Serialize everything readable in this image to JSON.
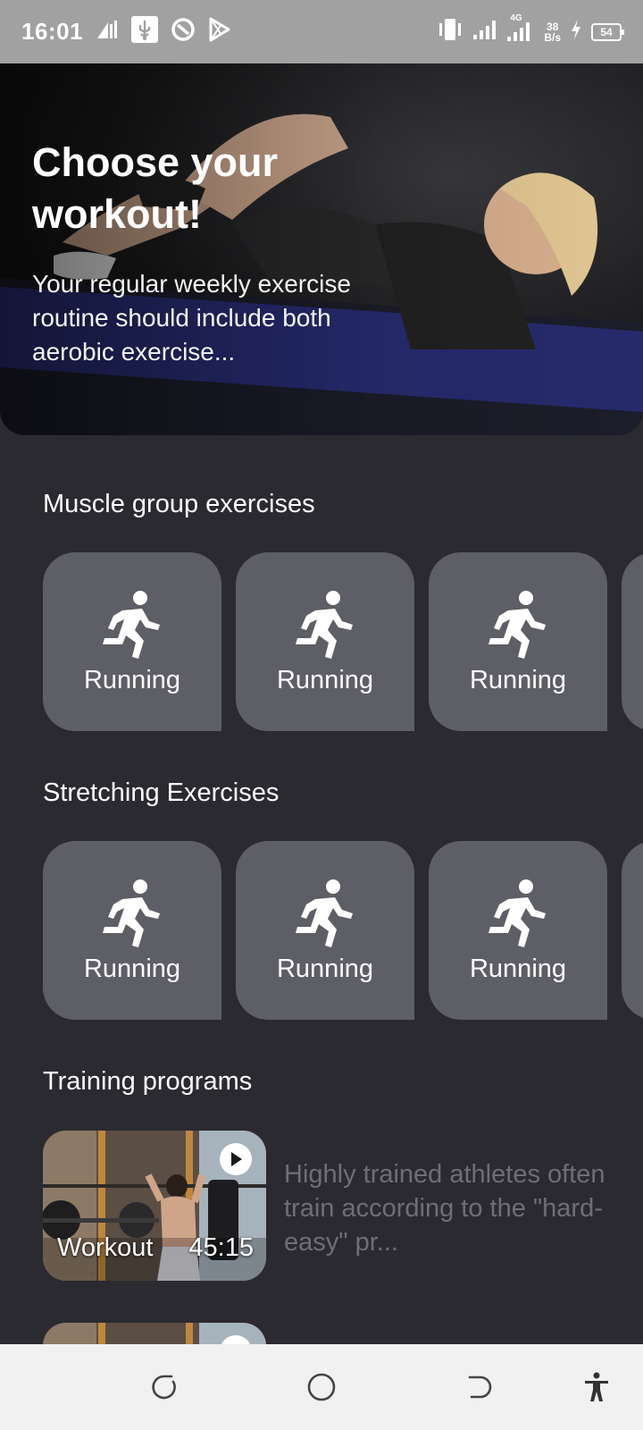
{
  "status_bar": {
    "time": "16:01",
    "net_speed_value": "38",
    "net_speed_unit": "B/s",
    "network_type": "4G",
    "battery_level": "54",
    "left_icons": [
      "sim-data-icon",
      "usb-icon",
      "vpn-icon",
      "play-store-icon"
    ],
    "right_icons": [
      "vibrate-icon",
      "signal-icon",
      "signal-4g-icon",
      "charging-icon",
      "battery-icon"
    ]
  },
  "hero": {
    "title": "Choose your workout!",
    "description": "Your regular weekly exercise routine should include both aerobic exercise..."
  },
  "muscle_group": {
    "title": "Muscle group exercises",
    "cards": [
      {
        "label": "Running",
        "icon": "running-icon"
      },
      {
        "label": "Running",
        "icon": "running-icon"
      },
      {
        "label": "Running",
        "icon": "running-icon"
      }
    ]
  },
  "stretching": {
    "title": "Stretching Exercises",
    "cards": [
      {
        "label": "Running",
        "icon": "running-icon"
      },
      {
        "label": "Running",
        "icon": "running-icon"
      },
      {
        "label": "Running",
        "icon": "running-icon"
      }
    ]
  },
  "training": {
    "title": "Training programs",
    "items": [
      {
        "caption_name": "Workout",
        "caption_duration": "45:15",
        "description": "Highly trained athletes often train according to the \"hard-easy\" pr..."
      }
    ]
  },
  "nav_bar": {
    "icons": [
      "recent-apps-icon",
      "home-icon",
      "back-icon",
      "accessibility-icon"
    ]
  },
  "colors": {
    "background": "#2b2a30",
    "card": "#5e5e66",
    "muted_text": "#6f6e74",
    "status_bar": "#a1a1a1",
    "nav_bar": "#f1f1f1"
  }
}
